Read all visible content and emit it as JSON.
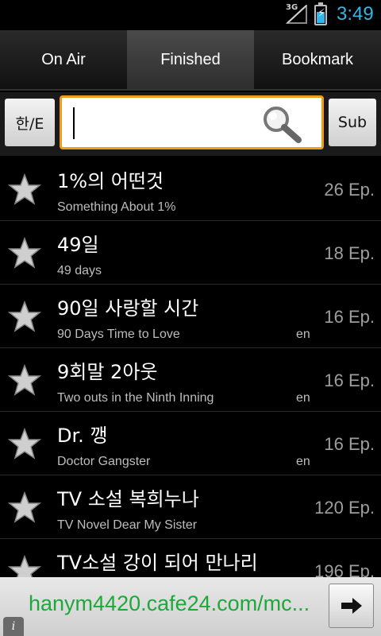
{
  "status": {
    "network": "3G",
    "time": "3:49"
  },
  "tabs": [
    {
      "label": "On Air",
      "active": false
    },
    {
      "label": "Finished",
      "active": true
    },
    {
      "label": "Bookmark",
      "active": false
    }
  ],
  "search": {
    "lang_label": "한/E",
    "value": "",
    "sub_label": "Sub",
    "icon": "search-icon"
  },
  "items": [
    {
      "title": "1%의 어떤것",
      "subtitle": "Something About 1%",
      "lang": "",
      "episodes": "26 Ep."
    },
    {
      "title": "49일",
      "subtitle": "49 days",
      "lang": "",
      "episodes": "18 Ep."
    },
    {
      "title": "90일 사랑할 시간",
      "subtitle": "90 Days Time to Love",
      "lang": "en",
      "episodes": "16 Ep."
    },
    {
      "title": "9회말 2아웃",
      "subtitle": "Two outs in the Ninth Inning",
      "lang": "en",
      "episodes": "16 Ep."
    },
    {
      "title": "Dr. 깽",
      "subtitle": "Doctor Gangster",
      "lang": "en",
      "episodes": "16 Ep."
    },
    {
      "title": "TV 소설 복희누나",
      "subtitle": "TV Novel Dear My Sister",
      "lang": "",
      "episodes": "120 Ep."
    },
    {
      "title": "TV소설 강이 되어 만나리",
      "subtitle": "",
      "lang": "",
      "episodes": "196 Ep."
    }
  ],
  "url": {
    "text": "hanym4420.cafe24.com/mc..."
  },
  "colors": {
    "accent": "#33b5e5",
    "search_border": "#f39c1c",
    "url_text": "#1ea83a"
  }
}
